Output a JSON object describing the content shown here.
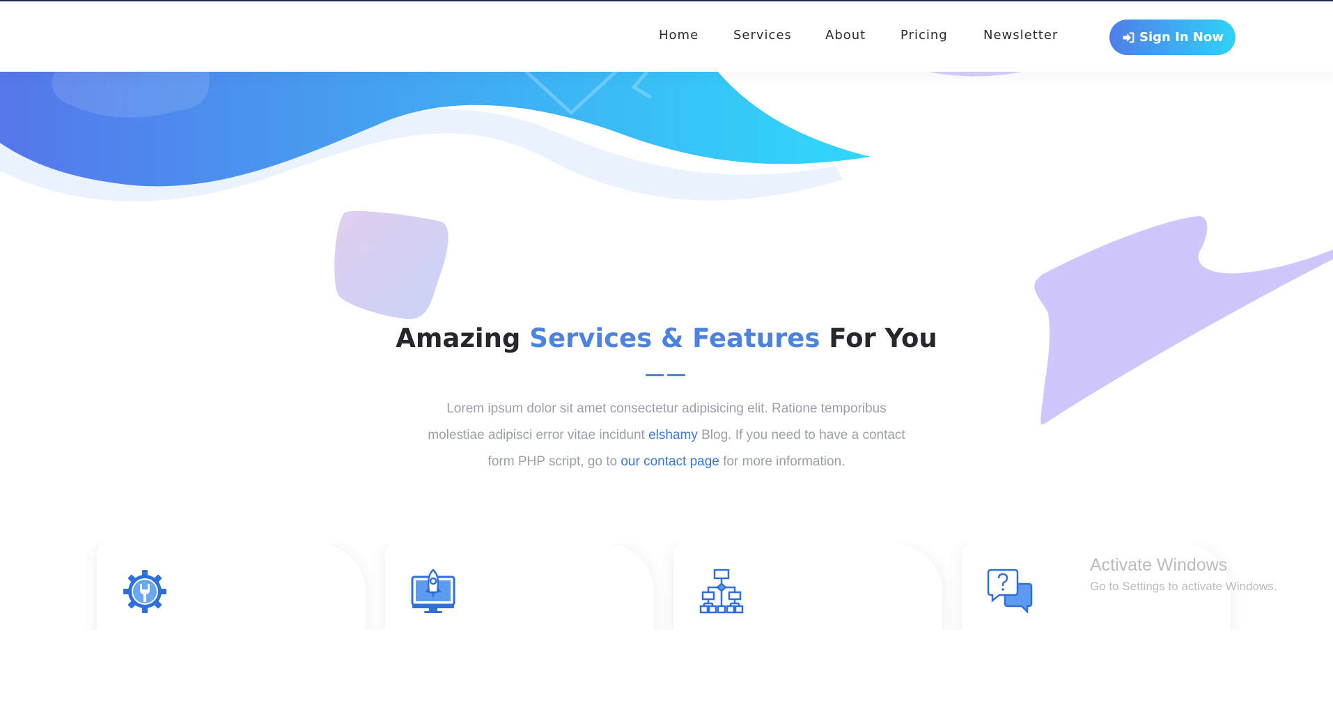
{
  "nav": {
    "items": [
      {
        "label": "Home"
      },
      {
        "label": "Services"
      },
      {
        "label": "About"
      },
      {
        "label": "Pricing"
      },
      {
        "label": "Newsletter"
      }
    ],
    "signin_label": "Sign In Now"
  },
  "section": {
    "title_prefix": "Amazing ",
    "title_accent": "Services & Features",
    "title_suffix": " For You",
    "intro_part1": "Lorem ipsum dolor sit amet consectetur adipisicing elit. Ratione temporibus molestiae adipisci error vitae incidunt ",
    "intro_link1": "elshamy",
    "intro_part2": " Blog. If you need to have a contact form PHP script, go to ",
    "intro_link2": "our contact page",
    "intro_part3": " for more information."
  },
  "cards": [
    {
      "icon": "gear-wrench-icon"
    },
    {
      "icon": "monitor-rocket-icon"
    },
    {
      "icon": "sitemap-icon"
    },
    {
      "icon": "chat-question-icon"
    }
  ],
  "watermark": {
    "title": "Activate Windows",
    "subtitle": "Go to Settings to activate Windows."
  },
  "colors": {
    "accent": "#4d83e0",
    "gradient_start": "#5577ea",
    "gradient_end": "#2fd8fb",
    "blob_purple": "#cfc6fb"
  }
}
